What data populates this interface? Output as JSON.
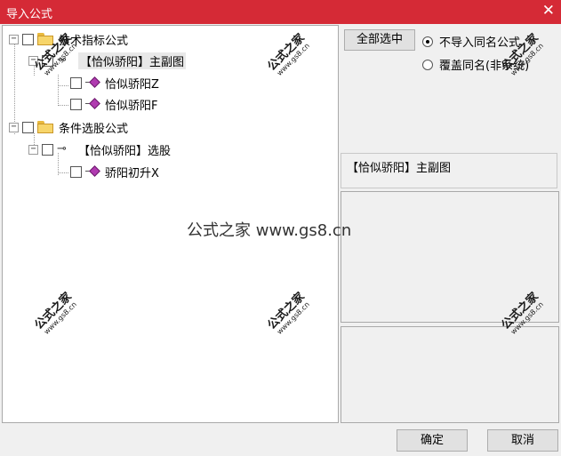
{
  "window": {
    "title": "导入公式",
    "close_glyph": "✕"
  },
  "tree": {
    "expander_glyph": "−",
    "nodes": [
      {
        "label": "技术指标公式",
        "icon": "folder-icon"
      },
      {
        "label": "【恰似骄阳】主副图",
        "icon": "key-icon",
        "key_glyph": "⊸"
      },
      {
        "label": "恰似骄阳Z",
        "icon": "gem-icon"
      },
      {
        "label": "恰似骄阳F",
        "icon": "gem-icon"
      },
      {
        "label": "条件选股公式",
        "icon": "folder-icon"
      },
      {
        "label": "【恰似骄阳】选股",
        "icon": "key-icon",
        "key_glyph": "⊸"
      },
      {
        "label": "骄阳初升X",
        "icon": "gem-icon"
      }
    ]
  },
  "options": {
    "select_all_label": "全部选中",
    "radio_skip_label": "不导入同名公式",
    "radio_overwrite_label": "覆盖同名(非系统)",
    "selected_radio": "skip"
  },
  "info": {
    "selected_formula": "【恰似骄阳】主副图"
  },
  "footer": {
    "ok_label": "确定",
    "cancel_label": "取消"
  },
  "watermark": {
    "big": "公式之家",
    "small": "www.gs8.cn",
    "center": "公式之家 www.gs8.cn"
  },
  "colors": {
    "titlebar": "#d52a36",
    "folder": "#f7d56a",
    "gem": "#b03ab0"
  }
}
